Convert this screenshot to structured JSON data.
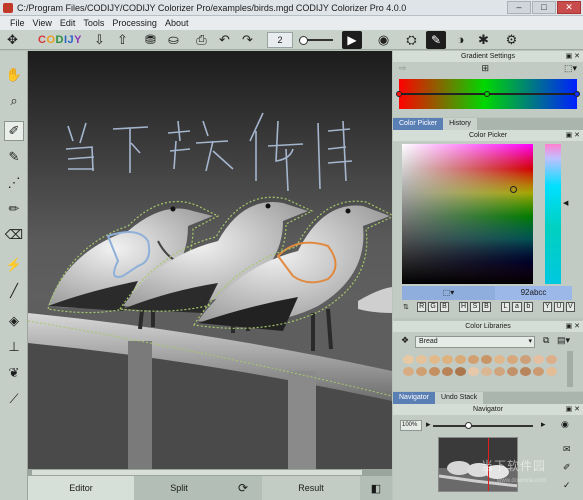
{
  "window": {
    "title": "C:/Program Files/CODIJY/CODIJY Colorizer Pro/examples/birds.mgd CODIJY Colorizer Pro 4.0.0",
    "buttons": [
      "–",
      "□",
      "✕"
    ]
  },
  "menu": [
    "File",
    "View",
    "Edit",
    "Tools",
    "Processing",
    "About"
  ],
  "toolbar": {
    "logo": [
      "C",
      "O",
      "D",
      "I",
      "J",
      "Y"
    ],
    "brush_size": "2"
  },
  "canvas": {
    "handwriting": "当下软件"
  },
  "bottom_tabs": {
    "editor": "Editor",
    "split": "Split",
    "result": "Result"
  },
  "gradient": {
    "title": "Gradient Settings",
    "stops": [
      "#ff1010",
      "#00d000",
      "#1030ff"
    ]
  },
  "color_tabs": [
    "Color Picker",
    "History"
  ],
  "color_picker": {
    "title": "Color Picker",
    "hex_value": "92abcc",
    "modes": [
      "R",
      "G",
      "B",
      "H",
      "S",
      "B",
      "L",
      "a",
      "b",
      "Y",
      "U",
      "V"
    ]
  },
  "libraries": {
    "title": "Color Libraries",
    "selected": "Bread",
    "swatches": [
      "#e9c8a4",
      "#e6c29a",
      "#e2b98a",
      "#ddb27f",
      "#d9ab79",
      "#d2a070",
      "#c99566",
      "#e0b88e",
      "#d8a87c",
      "#cda07a",
      "#e6bfa0",
      "#dcae8a",
      "#d8ad84",
      "#cf9f72",
      "#c49062",
      "#b98357",
      "#ad774e",
      "#e7c8a8",
      "#dab693",
      "#d0a47c",
      "#c39169",
      "#b7845c",
      "#cc9a70",
      "#e2bd96"
    ]
  },
  "nav_tabs": [
    "Navigator",
    "Undo Stack"
  ],
  "navigator": {
    "title": "Navigator",
    "zoom": "100%"
  },
  "watermark": {
    "text": "当下软件园",
    "url": "www.downxia.com"
  }
}
